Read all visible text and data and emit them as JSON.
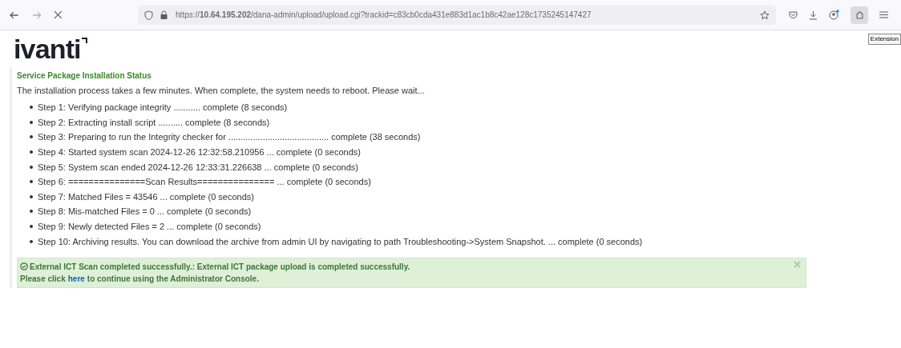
{
  "browser": {
    "url": "https://**10.64.195.202**/dana-admin/upload/upload.cgi?trackid=c83cb0cda431e883d1ac1b8c42ae128c1735245147427",
    "tooltip": "Extension"
  },
  "logo": "ivanti",
  "page": {
    "heading": "Service Package Installation Status",
    "intro": "The installation process takes a few minutes. When complete, the system needs to reboot. Please wait...",
    "steps": [
      "Step 1: Verifying package integrity ........... complete (8 seconds)",
      "Step 2: Extracting install script .......... complete (8 seconds)",
      "Step 3: Preparing to run the Integrity checker for ......................................... complete (38 seconds)",
      "Step 4: Started system scan 2024-12-26 12:32:58.210956 ... complete (0 seconds)",
      "Step 5: System scan ended 2024-12-26 12:33:31.226638 ... complete (0 seconds)",
      "Step 6: ===============Scan Results=============== ... complete (0 seconds)",
      "Step 7: Matched Files = 43546 ... complete (0 seconds)",
      "Step 8: Mis-matched Files = 0 ... complete (0 seconds)",
      "Step 9: Newly detected Files = 2 ... complete (0 seconds)",
      "Step 10: Archiving results. You can download the archive from admin UI by navigating to path Troubleshooting->System Snapshot. ... complete (0 seconds)"
    ],
    "alert": {
      "message": "External ICT Scan completed successfully.:  External ICT package upload is completed successfully.",
      "line2_before": "Please click",
      "link": "here",
      "line2_after": "to continue using the Administrator Console."
    }
  }
}
